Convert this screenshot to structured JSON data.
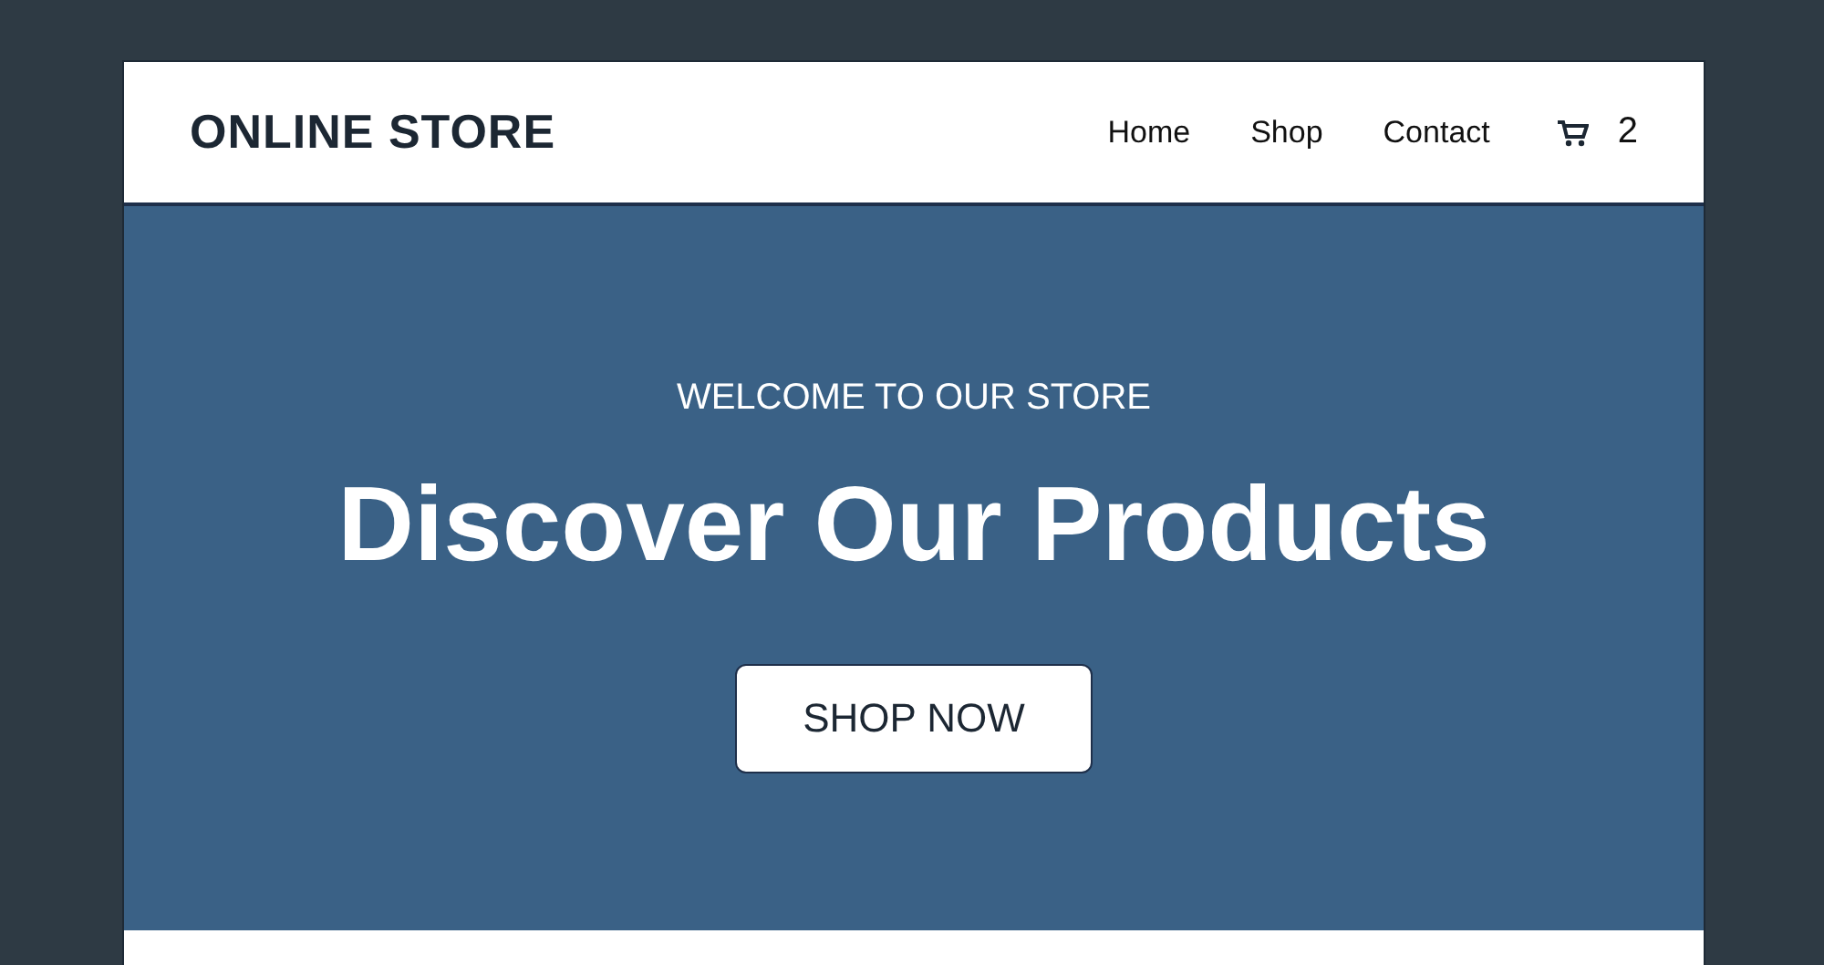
{
  "header": {
    "logo": "ONLINE STORE",
    "nav": [
      {
        "label": "Home"
      },
      {
        "label": "Shop"
      },
      {
        "label": "Contact"
      }
    ],
    "cart_count": "2"
  },
  "hero": {
    "eyebrow": "WELCOME TO OUR STORE",
    "title": "Discover Our Products",
    "button": "SHOP NOW"
  }
}
